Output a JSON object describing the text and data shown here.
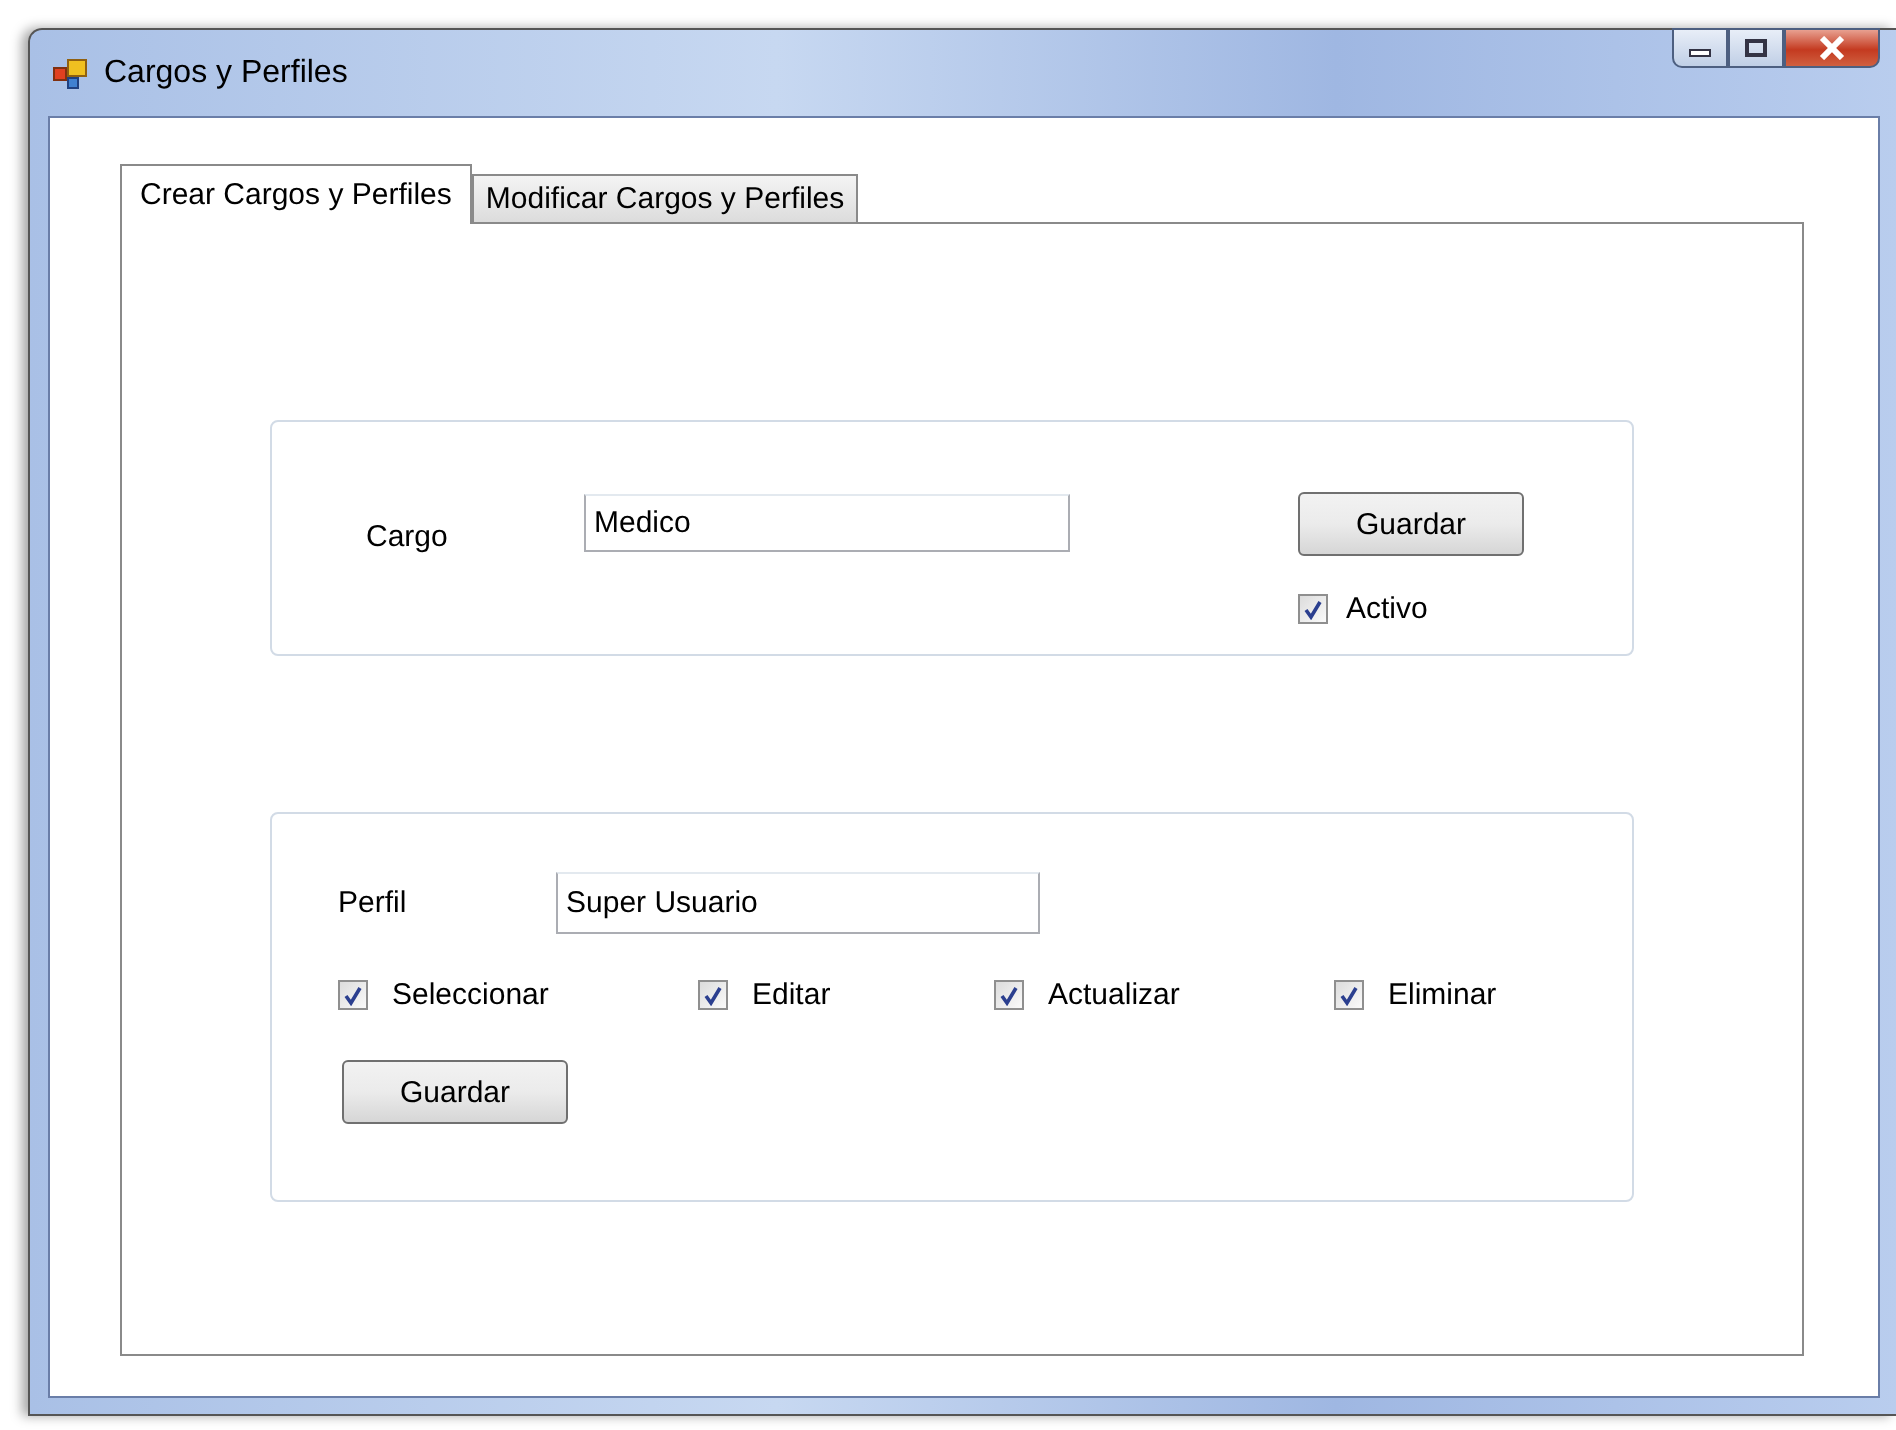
{
  "window": {
    "title": "Cargos y Perfiles"
  },
  "tabs": [
    {
      "label": "Crear Cargos y Perfiles",
      "selected": true
    },
    {
      "label": "Modificar Cargos y Perfiles",
      "selected": false
    }
  ],
  "cargo": {
    "label": "Cargo",
    "value": "Medico",
    "button": "Guardar",
    "active": {
      "label": "Activo",
      "checked": true
    }
  },
  "perfil": {
    "label": "Perfil",
    "value": "Super Usuario",
    "permissions": [
      {
        "label": "Seleccionar",
        "checked": true
      },
      {
        "label": "Editar",
        "checked": true
      },
      {
        "label": "Actualizar",
        "checked": true
      },
      {
        "label": "Eliminar",
        "checked": true
      }
    ],
    "button": "Guardar"
  }
}
